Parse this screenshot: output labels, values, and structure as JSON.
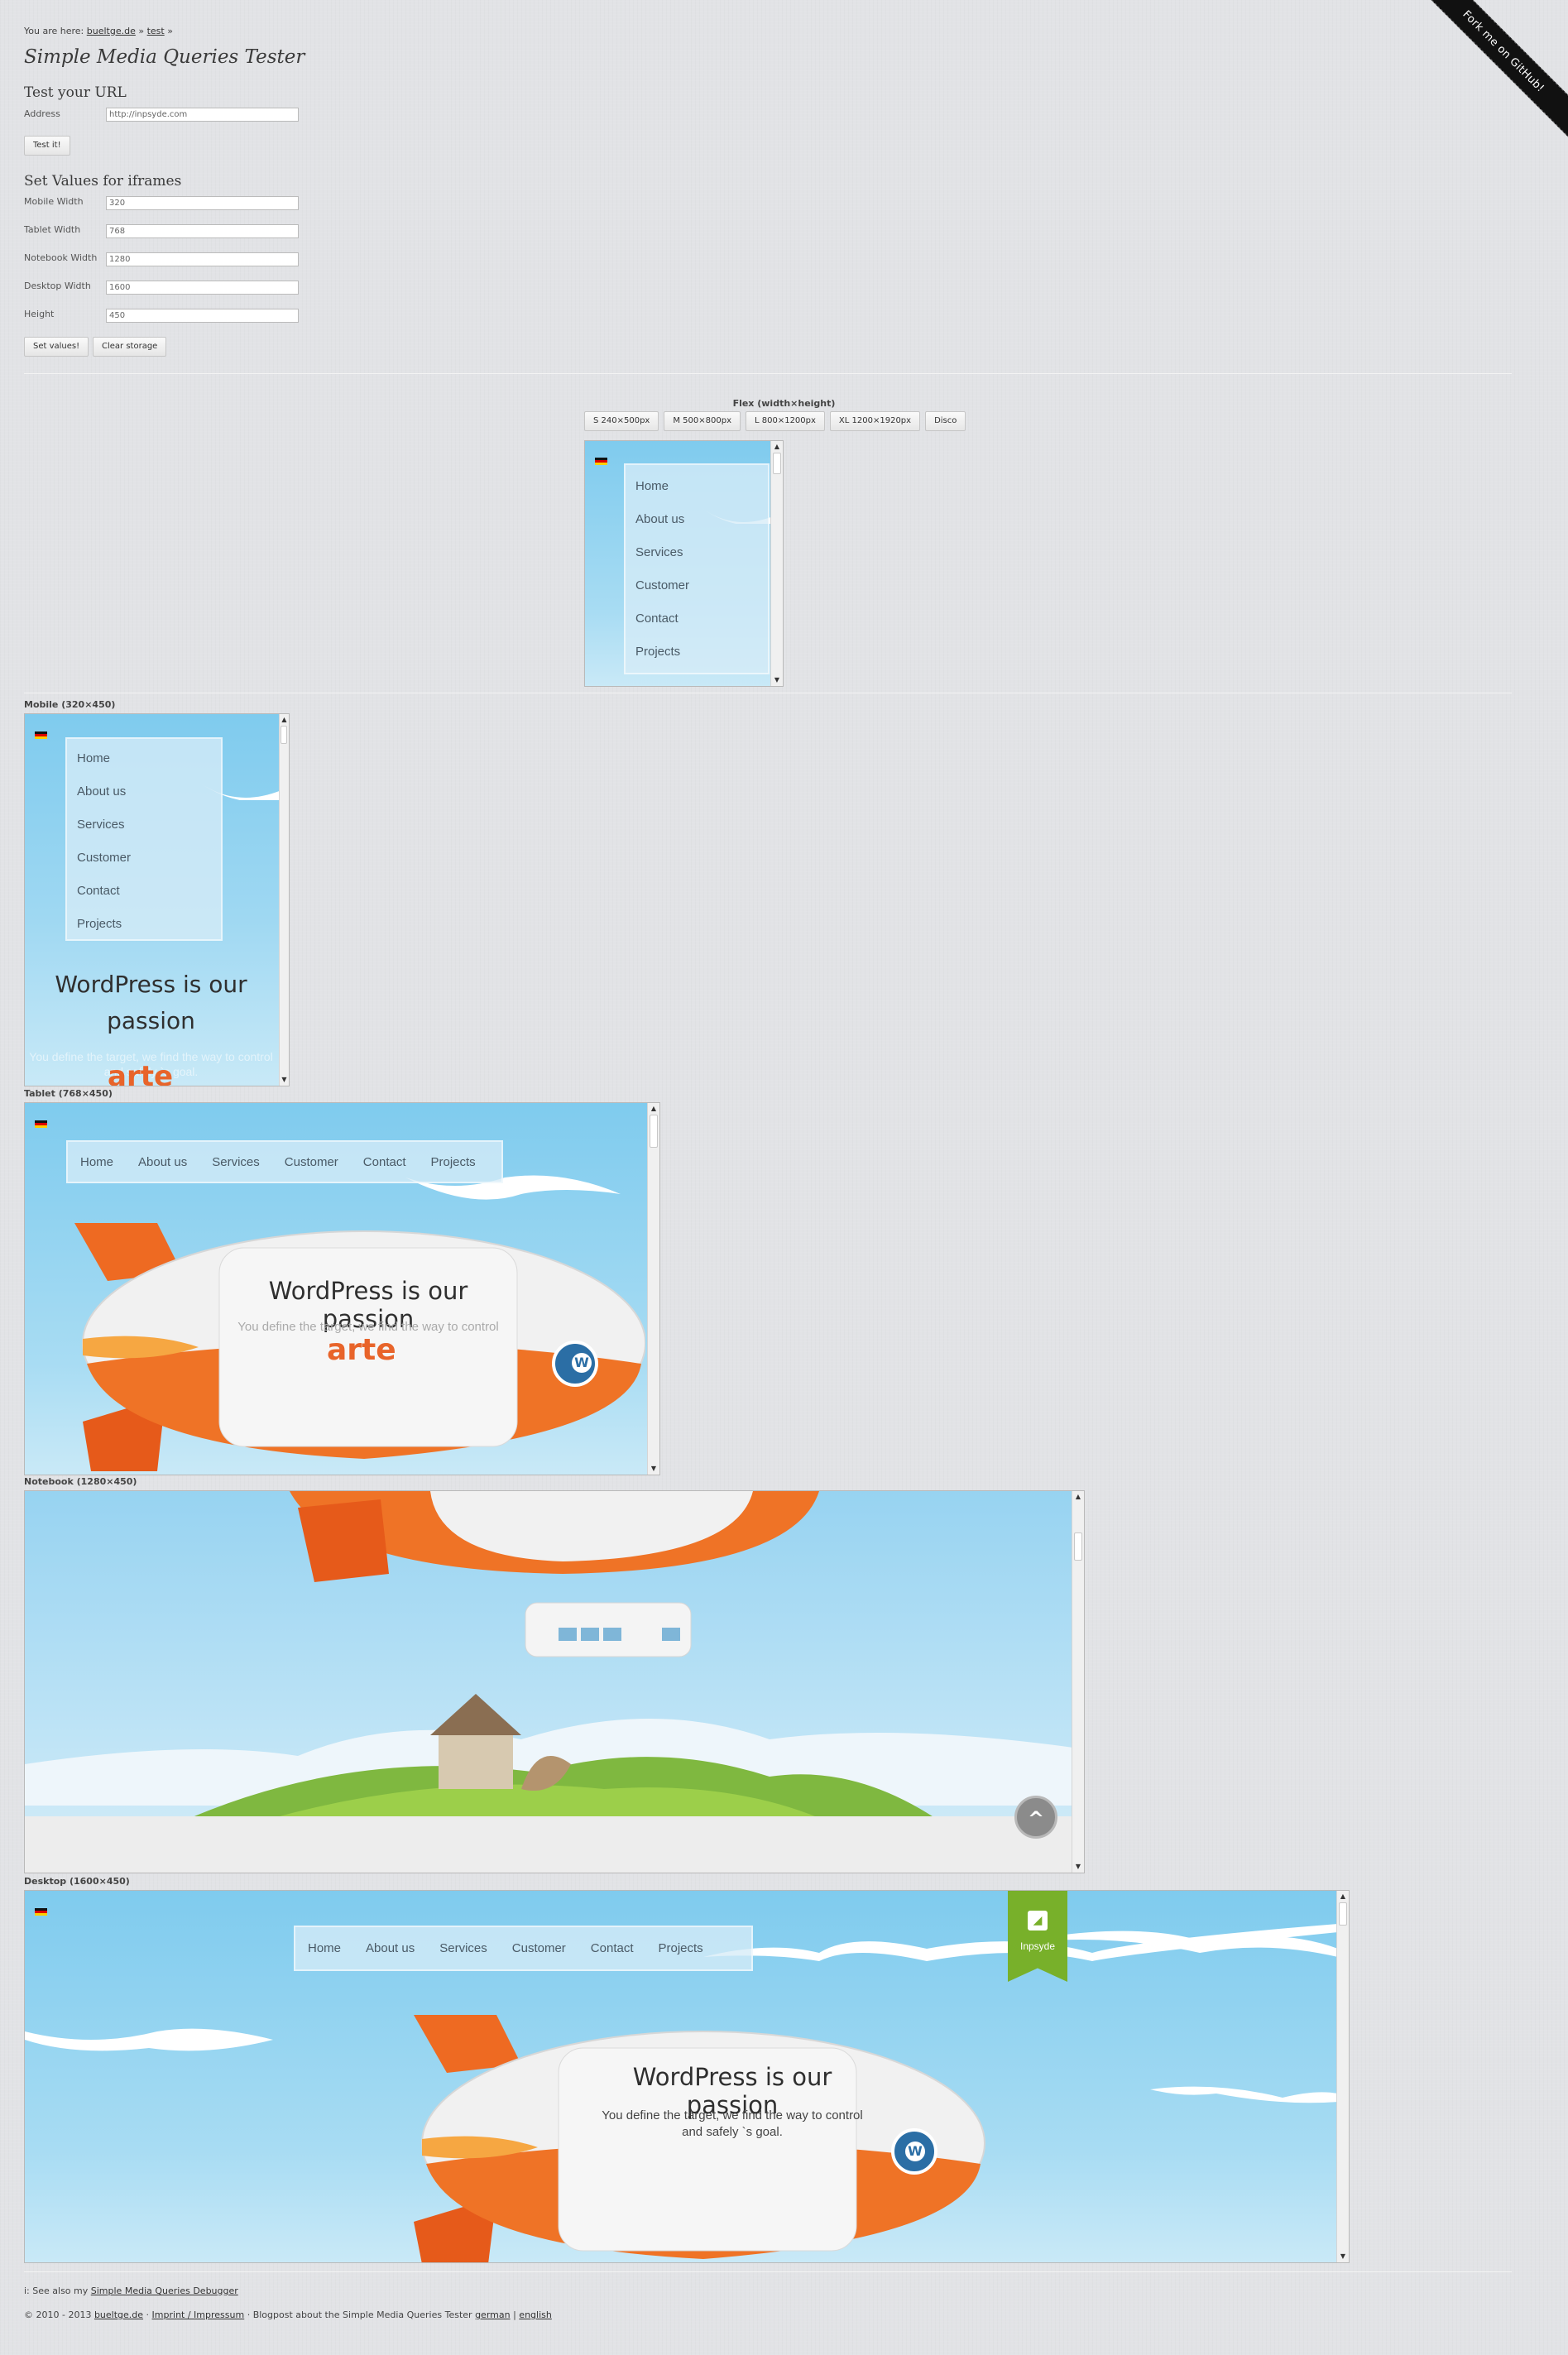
{
  "ribbon": {
    "text": "Fork me on GitHub!"
  },
  "breadcrumb": {
    "prefix": "You are here:",
    "home": "bueltge.de",
    "sep1": "»",
    "current": "test",
    "sep2": "»"
  },
  "page_title": "Simple Media Queries Tester",
  "url_section": {
    "title": "Test your URL",
    "address_label": "Address",
    "address_value": "http://inpsyde.com",
    "test_button": "Test it!"
  },
  "values_section": {
    "title": "Set Values for iframes",
    "fields": [
      {
        "label": "Mobile Width",
        "value": "320"
      },
      {
        "label": "Tablet Width",
        "value": "768"
      },
      {
        "label": "Notebook Width",
        "value": "1280"
      },
      {
        "label": "Desktop Width",
        "value": "1600"
      },
      {
        "label": "Height",
        "value": "450"
      }
    ],
    "set_button": "Set values!",
    "clear_button": "Clear storage"
  },
  "flex": {
    "label": "Flex (width×height)",
    "buttons": [
      "S 240×500px",
      "M 500×800px",
      "L 800×1200px",
      "XL 1200×1920px",
      "Disco"
    ]
  },
  "frames": {
    "mobile": "Mobile (320×450)",
    "tablet": "Tablet (768×450)",
    "notebook": "Notebook (1280×450)",
    "desktop": "Desktop (1600×450)"
  },
  "site": {
    "menu": [
      "Home",
      "About us",
      "Services",
      "Customer",
      "Contact",
      "Projects"
    ],
    "hero_title": "WordPress is our passion",
    "hero_title_l1": "WordPress is our",
    "hero_title_l2": "passion",
    "hero_sub": "You define the target, we find the way to control and safely `s goal.",
    "hero_sub_l1": "You define the target, we find the way to control",
    "hero_sub_l2": "and safely `s goal.",
    "client_logo": "arte",
    "badge": "Inpsyde",
    "back_to_top": "^"
  },
  "footer": {
    "see_also_prefix": "i: See also my",
    "see_also_link": "Simple Media Queries Debugger",
    "copyright": "© 2010 - 2013",
    "site_link": "bueltge.de",
    "sep": "·",
    "imprint": "Imprint / Impressum",
    "blogpost_text": "· Blogpost about the Simple Media Queries Tester",
    "german": "german",
    "pipe": "|",
    "english": "english"
  },
  "colors": {
    "sky": "#7fcbee",
    "orange": "#f07a2a",
    "badge_green": "#78b02a",
    "background": "#e2e3e6"
  }
}
